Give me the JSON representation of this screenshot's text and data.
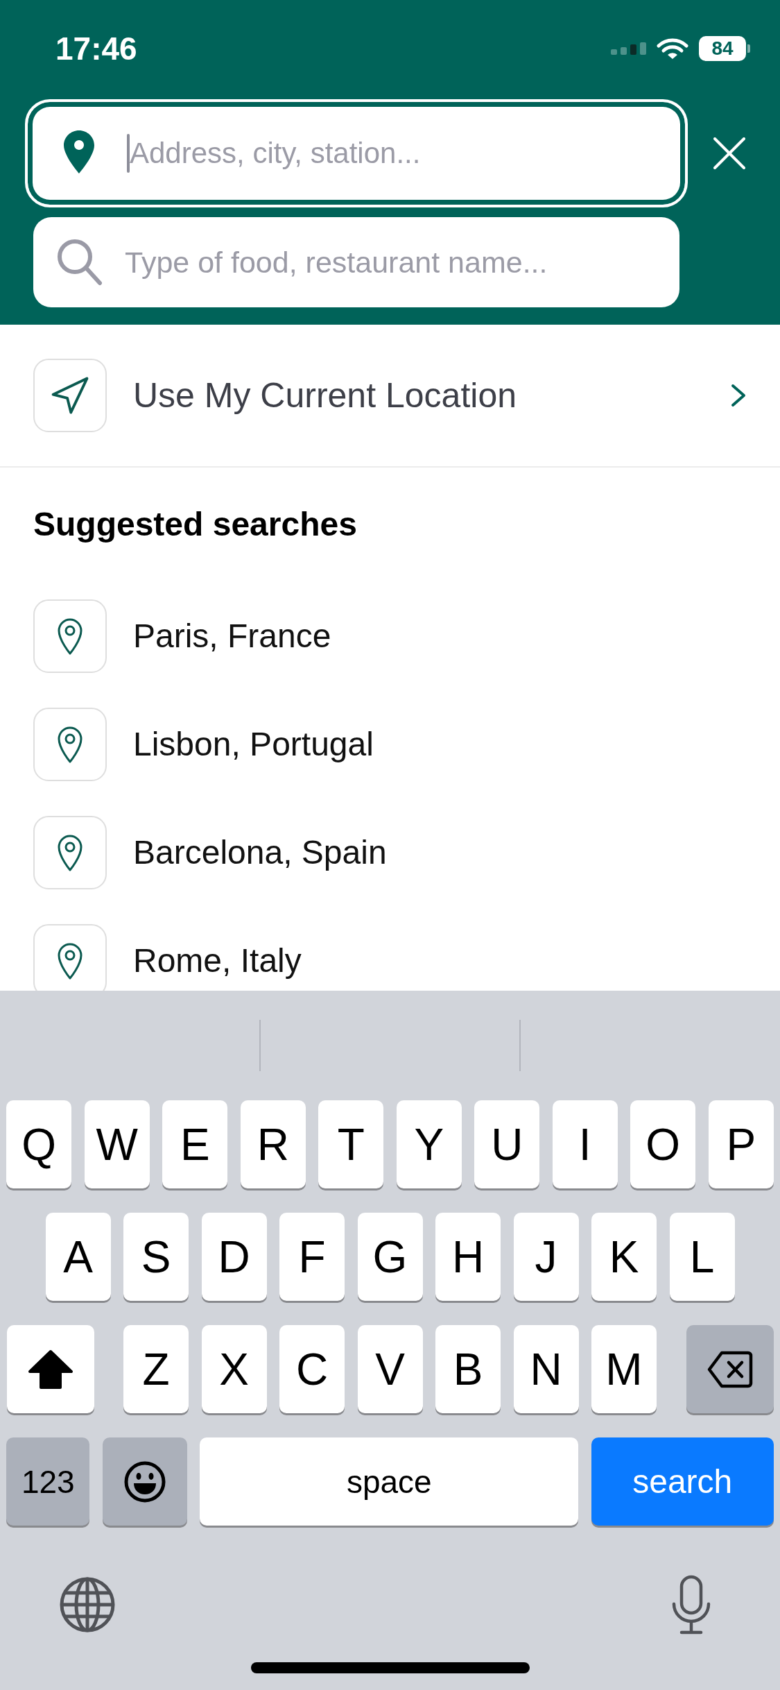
{
  "status_bar": {
    "time": "17:46",
    "battery": "84"
  },
  "search": {
    "location_field": {
      "placeholder": "Address, city, station...",
      "focused": true
    },
    "food_field": {
      "placeholder": "Type of food, restaurant name..."
    }
  },
  "current_location": {
    "label": "Use My Current Location"
  },
  "suggested_searches": {
    "title": "Suggested searches",
    "items": [
      {
        "label": "Paris, France"
      },
      {
        "label": "Lisbon, Portugal"
      },
      {
        "label": "Barcelona, Spain"
      },
      {
        "label": "Rome, Italy"
      }
    ]
  },
  "keyboard": {
    "rows": [
      {
        "keys": [
          {
            "kind": "letter",
            "label": "Q"
          },
          {
            "kind": "letter",
            "label": "W"
          },
          {
            "kind": "letter",
            "label": "E"
          },
          {
            "kind": "letter",
            "label": "R"
          },
          {
            "kind": "letter",
            "label": "T"
          },
          {
            "kind": "letter",
            "label": "Y"
          },
          {
            "kind": "letter",
            "label": "U"
          },
          {
            "kind": "letter",
            "label": "I"
          },
          {
            "kind": "letter",
            "label": "O"
          },
          {
            "kind": "letter",
            "label": "P"
          }
        ]
      },
      {
        "keys": [
          {
            "kind": "letter",
            "label": "A"
          },
          {
            "kind": "letter",
            "label": "S"
          },
          {
            "kind": "letter",
            "label": "D"
          },
          {
            "kind": "letter",
            "label": "F"
          },
          {
            "kind": "letter",
            "label": "G"
          },
          {
            "kind": "letter",
            "label": "H"
          },
          {
            "kind": "letter",
            "label": "J"
          },
          {
            "kind": "letter",
            "label": "K"
          },
          {
            "kind": "letter",
            "label": "L"
          }
        ]
      },
      {
        "keys": [
          {
            "kind": "shift",
            "on": true
          },
          {
            "kind": "letter",
            "label": "Z"
          },
          {
            "kind": "letter",
            "label": "X"
          },
          {
            "kind": "letter",
            "label": "C"
          },
          {
            "kind": "letter",
            "label": "V"
          },
          {
            "kind": "letter",
            "label": "B"
          },
          {
            "kind": "letter",
            "label": "N"
          },
          {
            "kind": "letter",
            "label": "M"
          },
          {
            "kind": "backspace"
          }
        ]
      },
      {
        "keys": [
          {
            "kind": "numbers",
            "label": "123"
          },
          {
            "kind": "emoji"
          },
          {
            "kind": "space",
            "label": "space"
          },
          {
            "kind": "action",
            "label": "search"
          }
        ]
      }
    ]
  }
}
